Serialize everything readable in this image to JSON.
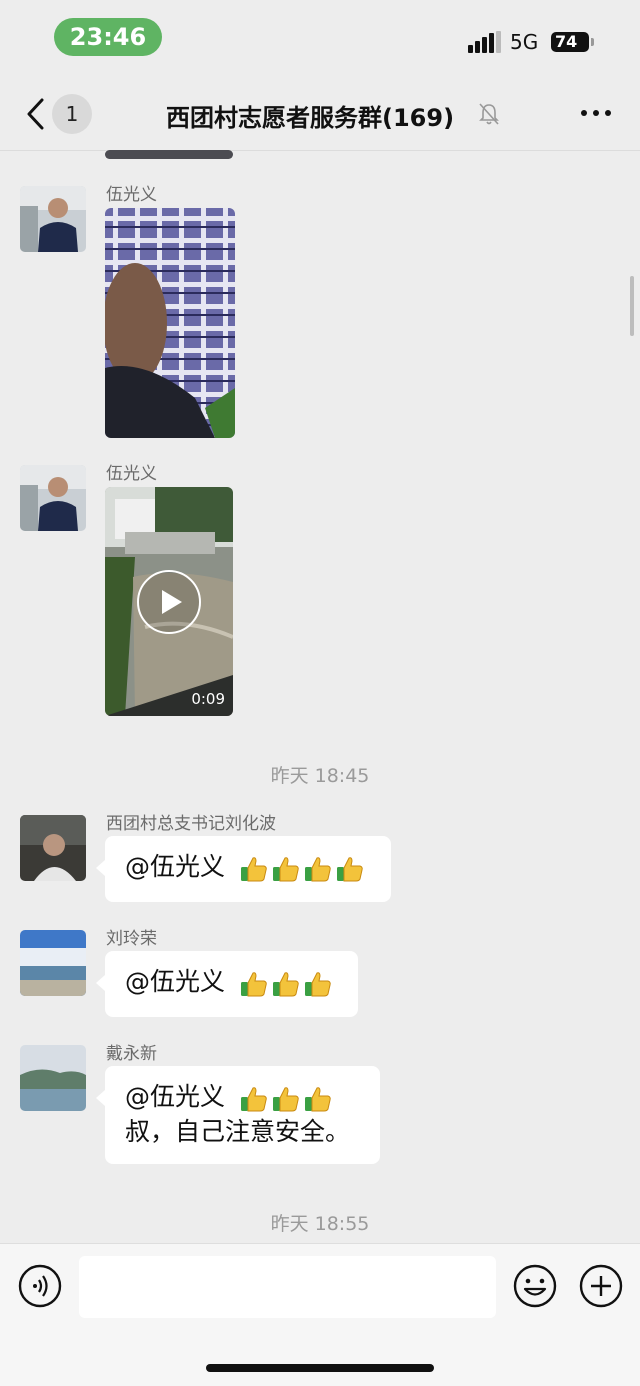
{
  "status_bar": {
    "time": "23:46",
    "network": "5G",
    "battery": "74"
  },
  "nav": {
    "unread_count": "1",
    "title": "西团村志愿者服务群(169)"
  },
  "messages": [
    {
      "sender": "伍光义",
      "type": "image"
    },
    {
      "sender": "伍光义",
      "type": "video",
      "duration": "0:09"
    }
  ],
  "time_separators": [
    "昨天 18:45",
    "昨天 18:55"
  ],
  "text_messages": [
    {
      "sender": "西团村总支书记刘化波",
      "mention": "@伍光义",
      "thumbs_up": 4,
      "text": ""
    },
    {
      "sender": "刘玲荣",
      "mention": "@伍光义",
      "thumbs_up": 3,
      "text": ""
    },
    {
      "sender": "戴永新",
      "mention": "@伍光义",
      "thumbs_up": 3,
      "text": "叔，自己注意安全。"
    }
  ],
  "colors": {
    "time_pill": "#5fb463",
    "background": "#ededed",
    "bubble": "#ffffff"
  },
  "icons": [
    "back-icon",
    "mute-bell-icon",
    "more-icon",
    "play-icon",
    "voice-icon",
    "emoji-icon",
    "plus-icon",
    "thumbs-up-icon"
  ]
}
